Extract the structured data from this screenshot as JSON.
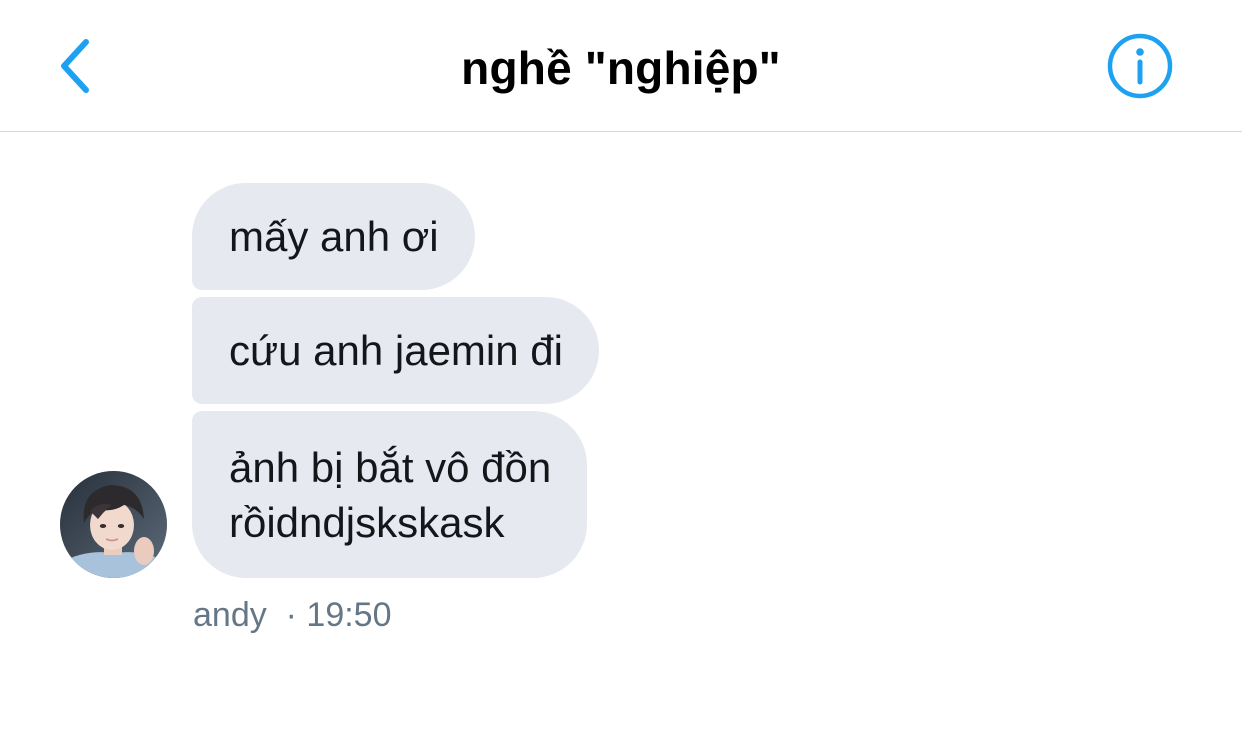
{
  "header": {
    "title": "nghề \"nghiệp\"",
    "back_icon": "chevron-left-icon",
    "info_icon": "info-circle-icon",
    "accent_color": "#1da1f2"
  },
  "messages": [
    {
      "text": "mấy anh ơi"
    },
    {
      "text": "cứu anh jaemin đi"
    },
    {
      "lines": [
        "ảnh bị bắt vô đồn",
        "rồidndjskskask"
      ]
    }
  ],
  "sender": {
    "name": "andy",
    "time": "19:50",
    "separator": "·"
  },
  "colors": {
    "bubble_bg": "#e6e9ef",
    "meta_text": "#657786",
    "divider": "#d6d9dc"
  }
}
